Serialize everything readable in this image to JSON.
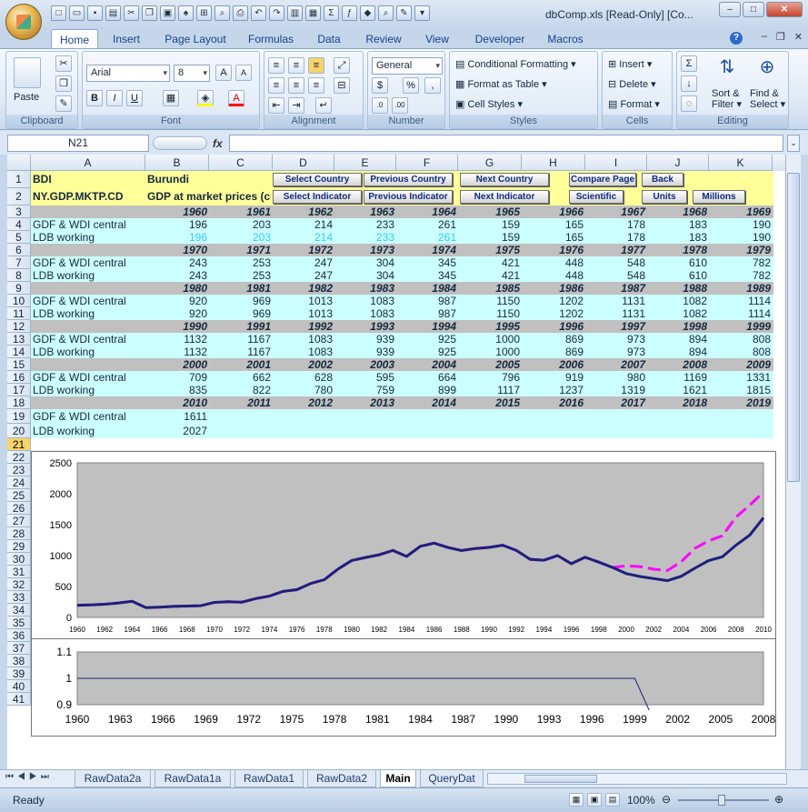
{
  "window": {
    "title": "dbComp.xls  [Read-Only]  [Co..."
  },
  "ribbon": {
    "tabs": [
      "Home",
      "Insert",
      "Page Layout",
      "Formulas",
      "Data",
      "Review",
      "View",
      "Developer",
      "Macros"
    ],
    "active_tab": "Home",
    "clipboard": {
      "paste": "Paste",
      "label": "Clipboard"
    },
    "font": {
      "name": "Arial",
      "size": "8",
      "label": "Font"
    },
    "alignment": {
      "label": "Alignment"
    },
    "number": {
      "format": "General",
      "label": "Number"
    },
    "styles": {
      "conditional": "Conditional Formatting",
      "format_table": "Format as Table",
      "cell_styles": "Cell Styles",
      "label": "Styles"
    },
    "cells": {
      "insert": "Insert",
      "delete": "Delete",
      "format": "Format",
      "label": "Cells"
    },
    "editing": {
      "sort": "Sort &",
      "filter": "Filter",
      "find": "Find &",
      "select": "Select",
      "label": "Editing"
    }
  },
  "formula_bar": {
    "name_box": "N21",
    "formula": ""
  },
  "columns": [
    "A",
    "B",
    "C",
    "D",
    "E",
    "F",
    "G",
    "H",
    "I",
    "J",
    "K"
  ],
  "rows": [
    "1",
    "2",
    "3",
    "4",
    "5",
    "6",
    "7",
    "8",
    "9",
    "10",
    "11",
    "12",
    "13",
    "14",
    "15",
    "16",
    "17",
    "18",
    "19",
    "20",
    "21",
    "22",
    "23",
    "24",
    "25",
    "26",
    "27",
    "28",
    "29",
    "30",
    "31",
    "32",
    "33",
    "34",
    "35",
    "36",
    "37",
    "38",
    "39",
    "40",
    "41"
  ],
  "sheet": {
    "a1": "BDI",
    "b1": "Burundi",
    "a2": "NY.GDP.MKTP.CD",
    "b2": "GDP at market prices (cu",
    "buttons_row1": [
      "Select Country",
      "Previous Country",
      "Next Country",
      "Compare Page",
      "Back"
    ],
    "buttons_row2": [
      "Select Indicator",
      "Previous Indicator",
      "Next Indicator",
      "Scientific",
      "Units",
      "Millions"
    ],
    "label_central": "GDF & WDI central",
    "label_working": "LDB working",
    "blocks": [
      {
        "years": [
          "1960",
          "1961",
          "1962",
          "1963",
          "1964",
          "1965",
          "1966",
          "1967",
          "1968",
          "1969"
        ],
        "central": [
          "196",
          "203",
          "214",
          "233",
          "261",
          "159",
          "165",
          "178",
          "183",
          "190"
        ],
        "working": [
          "196",
          "203",
          "214",
          "233",
          "261",
          "159",
          "165",
          "178",
          "183",
          "190"
        ]
      },
      {
        "years": [
          "1970",
          "1971",
          "1972",
          "1973",
          "1974",
          "1975",
          "1976",
          "1977",
          "1978",
          "1979"
        ],
        "central": [
          "243",
          "253",
          "247",
          "304",
          "345",
          "421",
          "448",
          "548",
          "610",
          "782"
        ],
        "working": [
          "243",
          "253",
          "247",
          "304",
          "345",
          "421",
          "448",
          "548",
          "610",
          "782"
        ]
      },
      {
        "years": [
          "1980",
          "1981",
          "1982",
          "1983",
          "1984",
          "1985",
          "1986",
          "1987",
          "1988",
          "1989"
        ],
        "central": [
          "920",
          "969",
          "1013",
          "1083",
          "987",
          "1150",
          "1202",
          "1131",
          "1082",
          "1114"
        ],
        "working": [
          "920",
          "969",
          "1013",
          "1083",
          "987",
          "1150",
          "1202",
          "1131",
          "1082",
          "1114"
        ]
      },
      {
        "years": [
          "1990",
          "1991",
          "1992",
          "1993",
          "1994",
          "1995",
          "1996",
          "1997",
          "1998",
          "1999"
        ],
        "central": [
          "1132",
          "1167",
          "1083",
          "939",
          "925",
          "1000",
          "869",
          "973",
          "894",
          "808"
        ],
        "working": [
          "1132",
          "1167",
          "1083",
          "939",
          "925",
          "1000",
          "869",
          "973",
          "894",
          "808"
        ]
      },
      {
        "years": [
          "2000",
          "2001",
          "2002",
          "2003",
          "2004",
          "2005",
          "2006",
          "2007",
          "2008",
          "2009"
        ],
        "central": [
          "709",
          "662",
          "628",
          "595",
          "664",
          "796",
          "919",
          "980",
          "1169",
          "1331"
        ],
        "working": [
          "835",
          "822",
          "780",
          "759",
          "899",
          "1117",
          "1237",
          "1319",
          "1621",
          "1815"
        ]
      },
      {
        "years": [
          "2010",
          "2011",
          "2012",
          "2013",
          "2014",
          "2015",
          "2016",
          "2017",
          "2018",
          "2019"
        ],
        "central": [
          "1611"
        ],
        "working": [
          "2027"
        ]
      }
    ]
  },
  "sheet_tabs": [
    "RawData2a",
    "RawData1a",
    "RawData1",
    "RawData2",
    "Main",
    "QueryDat"
  ],
  "active_sheet": "Main",
  "status": {
    "text": "Ready",
    "zoom": "100%"
  },
  "chart_data": [
    {
      "type": "line",
      "title": "",
      "ylim": [
        0,
        2500
      ],
      "yticks": [
        "0",
        "500",
        "1000",
        "1500",
        "2000",
        "2500"
      ],
      "xticks": [
        "1960",
        "1962",
        "1964",
        "1966",
        "1968",
        "1970",
        "1972",
        "1974",
        "1976",
        "1978",
        "1980",
        "1982",
        "1984",
        "1986",
        "1988",
        "1990",
        "1992",
        "1994",
        "1996",
        "1998",
        "2000",
        "2002",
        "2004",
        "2006",
        "2008",
        "2010"
      ],
      "x": [
        1960,
        1961,
        1962,
        1963,
        1964,
        1965,
        1966,
        1967,
        1968,
        1969,
        1970,
        1971,
        1972,
        1973,
        1974,
        1975,
        1976,
        1977,
        1978,
        1979,
        1980,
        1981,
        1982,
        1983,
        1984,
        1985,
        1986,
        1987,
        1988,
        1989,
        1990,
        1991,
        1992,
        1993,
        1994,
        1995,
        1996,
        1997,
        1998,
        1999,
        2000,
        2001,
        2002,
        2003,
        2004,
        2005,
        2006,
        2007,
        2008,
        2009,
        2010
      ],
      "series": [
        {
          "color": "#1f1f7a",
          "style": "solid",
          "values": [
            196,
            203,
            214,
            233,
            261,
            159,
            165,
            178,
            183,
            190,
            243,
            253,
            247,
            304,
            345,
            421,
            448,
            548,
            610,
            782,
            920,
            969,
            1013,
            1083,
            987,
            1150,
            1202,
            1131,
            1082,
            1114,
            1132,
            1167,
            1083,
            939,
            925,
            1000,
            869,
            973,
            894,
            808,
            709,
            662,
            628,
            595,
            664,
            796,
            919,
            980,
            1169,
            1331,
            1611
          ]
        },
        {
          "color": "#ff00ff",
          "style": "dashed",
          "values": [
            196,
            203,
            214,
            233,
            261,
            159,
            165,
            178,
            183,
            190,
            243,
            253,
            247,
            304,
            345,
            421,
            448,
            548,
            610,
            782,
            920,
            969,
            1013,
            1083,
            987,
            1150,
            1202,
            1131,
            1082,
            1114,
            1132,
            1167,
            1083,
            939,
            925,
            1000,
            869,
            973,
            894,
            808,
            835,
            822,
            780,
            759,
            899,
            1117,
            1237,
            1319,
            1621,
            1815,
            2027
          ]
        }
      ]
    },
    {
      "type": "line",
      "title": "",
      "ylim": [
        0.9,
        1.1
      ],
      "yticks": [
        "0.9",
        "1",
        "1.1"
      ],
      "xticks": [
        "1960",
        "1963",
        "1966",
        "1969",
        "1972",
        "1975",
        "1978",
        "1981",
        "1984",
        "1987",
        "1990",
        "1993",
        "1996",
        "1999",
        "2002",
        "2005",
        "2008"
      ],
      "x": [
        1960,
        1961,
        1962,
        1963,
        1964,
        1965,
        1966,
        1967,
        1968,
        1969,
        1970,
        1971,
        1972,
        1973,
        1974,
        1975,
        1976,
        1977,
        1978,
        1979,
        1980,
        1981,
        1982,
        1983,
        1984,
        1985,
        1986,
        1987,
        1988,
        1989,
        1990,
        1991,
        1992,
        1993,
        1994,
        1995,
        1996,
        1997,
        1998,
        1999,
        2000
      ],
      "series": [
        {
          "color": "#1f1f7a",
          "style": "solid",
          "values": [
            1,
            1,
            1,
            1,
            1,
            1,
            1,
            1,
            1,
            1,
            1,
            1,
            1,
            1,
            1,
            1,
            1,
            1,
            1,
            1,
            1,
            1,
            1,
            1,
            1,
            1,
            1,
            1,
            1,
            1,
            1,
            1,
            1,
            1,
            1,
            1,
            1,
            1,
            1,
            1,
            0.85
          ]
        }
      ]
    }
  ]
}
